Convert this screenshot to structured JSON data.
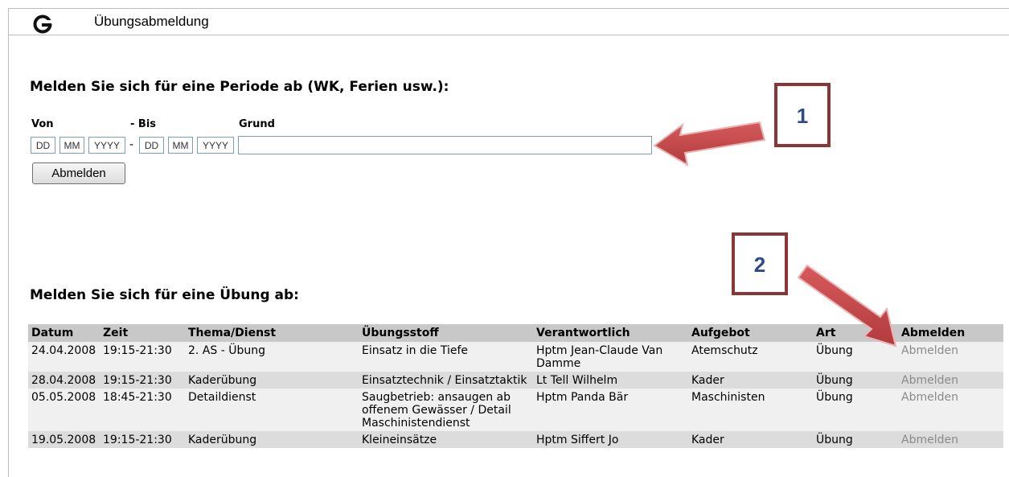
{
  "page": {
    "title": "Übungsabmeldung"
  },
  "period": {
    "heading": "Melden Sie sich für eine Periode ab (WK, Ferien usw.):",
    "von_label": "Von",
    "bis_label": "- Bis",
    "grund_label": "Grund",
    "dash": "-",
    "from": {
      "dd": "DD",
      "mm": "MM",
      "yyyy": "YYYY"
    },
    "to": {
      "dd": "DD",
      "mm": "MM",
      "yyyy": "YYYY"
    },
    "grund_value": "",
    "button": "Abmelden"
  },
  "exercise": {
    "heading": "Melden Sie sich für eine Übung ab:",
    "columns": [
      "Datum",
      "Zeit",
      "Thema/Dienst",
      "Übungsstoff",
      "Verantwortlich",
      "Aufgebot",
      "Art",
      "Abmelden"
    ],
    "rows": [
      [
        "24.04.2008",
        "19:15-21:30",
        "2. AS - Übung",
        "Einsatz in die Tiefe",
        "Hptm Jean-Claude Van Damme",
        "Atemschutz",
        "Übung",
        "Abmelden"
      ],
      [
        "28.04.2008",
        "19:15-21:30",
        "Kaderübung",
        "Einsatztechnik / Einsatztaktik",
        "Lt Tell Wilhelm",
        "Kader",
        "Übung",
        "Abmelden"
      ],
      [
        "05.05.2008",
        "18:45-21:30",
        "Detaildienst",
        "Saugbetrieb: ansaugen ab offenem Gewässer / Detail Maschinistendienst",
        "Hptm Panda Bär",
        "Maschinisten",
        "Übung",
        "Abmelden"
      ],
      [
        "19.05.2008",
        "19:15-21:30",
        "Kaderübung",
        "Kleineinsätze",
        "Hptm Siffert Jo",
        "Kader",
        "Übung",
        "Abmelden"
      ]
    ]
  },
  "annotations": {
    "callout1": "1",
    "callout2": "2"
  },
  "colors": {
    "arrow": "#c9484a",
    "callout_border": "#8b3536",
    "callout_text": "#2e4a8a"
  },
  "icons": {
    "logo": "back-arrow-logo-icon"
  }
}
